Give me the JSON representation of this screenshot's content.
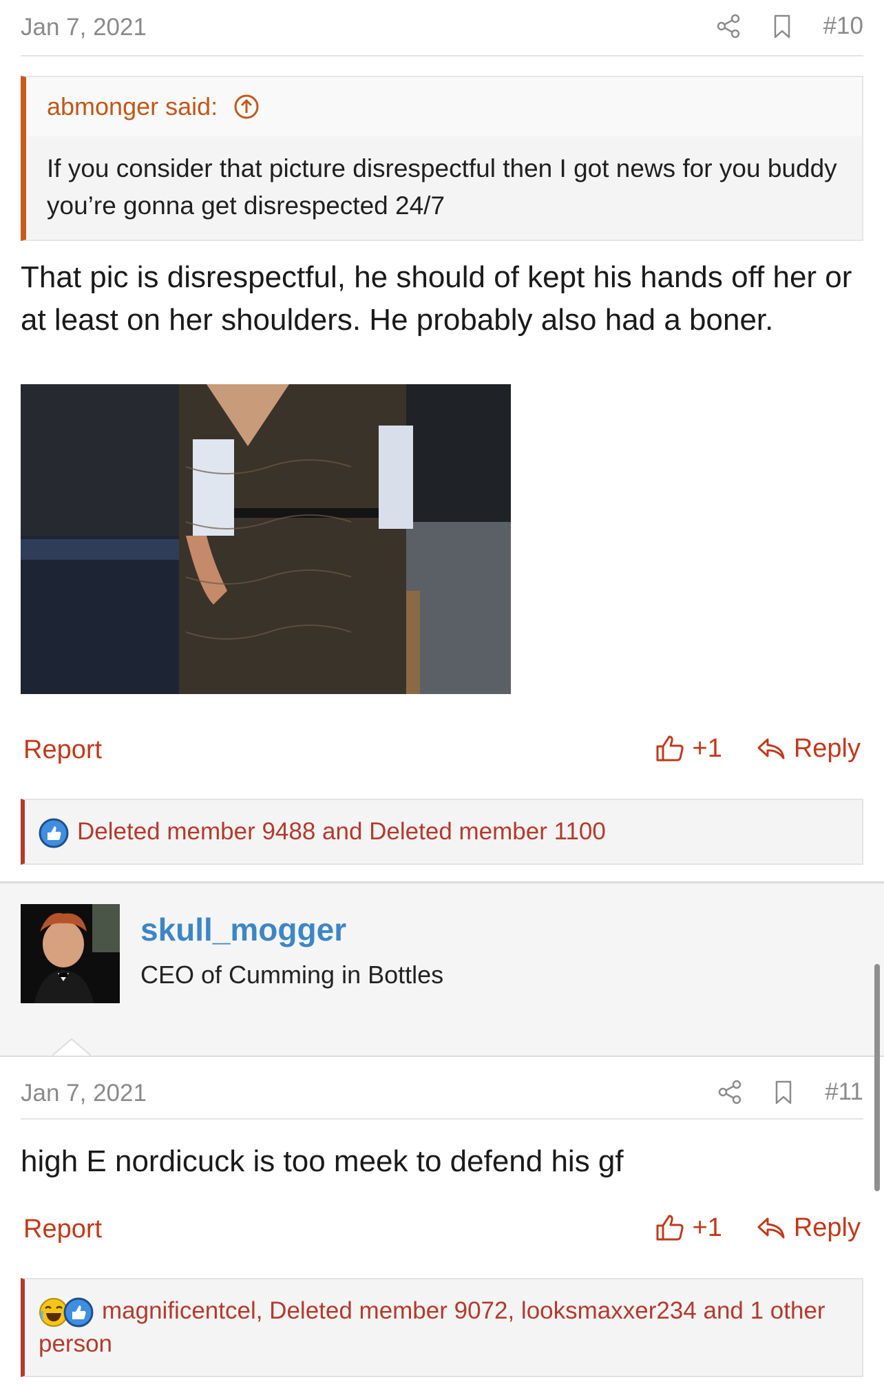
{
  "post10": {
    "date": "Jan 7, 2021",
    "number": "#10",
    "quote": {
      "author": "abmonger said:",
      "text": "If you consider that picture disrespectful then I got news for you buddy you’re gonna get disrespected 24/7"
    },
    "text": "That pic is disrespectful, he should of kept his hands off her or at least on her shoulders. He probably also had a boner.",
    "report_label": "Report",
    "like_count": "+1",
    "reply_label": "Reply",
    "reactions": "Deleted member 9488 and Deleted member 1100"
  },
  "user11": {
    "username": "skull_mogger",
    "title": "CEO of Cumming in Bottles"
  },
  "post11": {
    "date": "Jan 7, 2021",
    "number": "#11",
    "text": "high E nordicuck is too meek to defend his gf",
    "report_label": "Report",
    "like_count": "+1",
    "reply_label": "Reply",
    "reactions": "magnificentcel, Deleted member 9072, looksmaxxer234 and 1 other person"
  },
  "colors": {
    "accent_red": "#c0391b",
    "quote_border": "#c85a1c",
    "username_blue": "#3d86c6"
  },
  "icons": {
    "share": "share-icon",
    "bookmark": "bookmark-icon",
    "quote_jump": "arrow-up-circle-icon",
    "like": "thumbs-up-icon",
    "reply": "reply-arrow-icon",
    "reaction_like": "like-reaction-icon",
    "reaction_haha": "laugh-reaction-icon"
  }
}
